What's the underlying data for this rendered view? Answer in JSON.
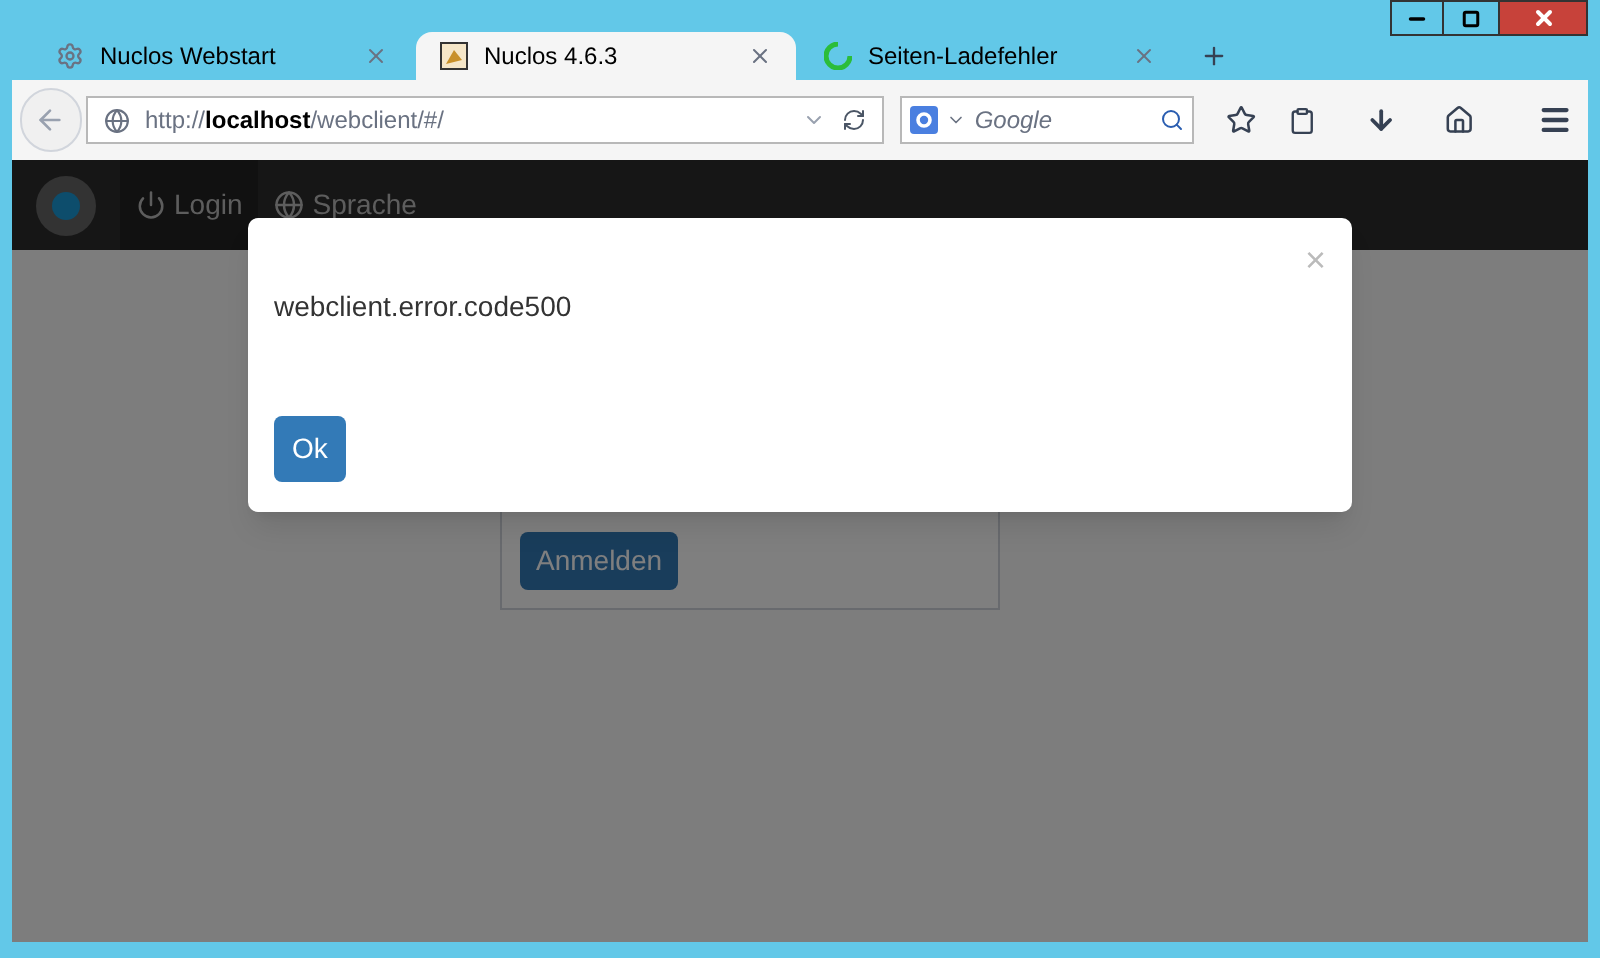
{
  "tabs": [
    {
      "title": "Nuclos Webstart",
      "kind": "gear",
      "selected": false
    },
    {
      "title": "Nuclos 4.6.3",
      "kind": "logo",
      "selected": true
    },
    {
      "title": "Seiten-Ladefehler",
      "kind": "loading",
      "selected": false
    }
  ],
  "address_bar": {
    "url": "http://**localhost**/webclient/#/"
  },
  "search": {
    "placeholder": "Google"
  },
  "navbar": {
    "items": [
      {
        "label": "Login",
        "kind": "power"
      },
      {
        "label": "Sprache",
        "kind": "globe"
      }
    ]
  },
  "login_card": {
    "submit": "Anmelden"
  },
  "dialog": {
    "message": "webclient.error.code500",
    "close": "×",
    "button": "Ok"
  }
}
